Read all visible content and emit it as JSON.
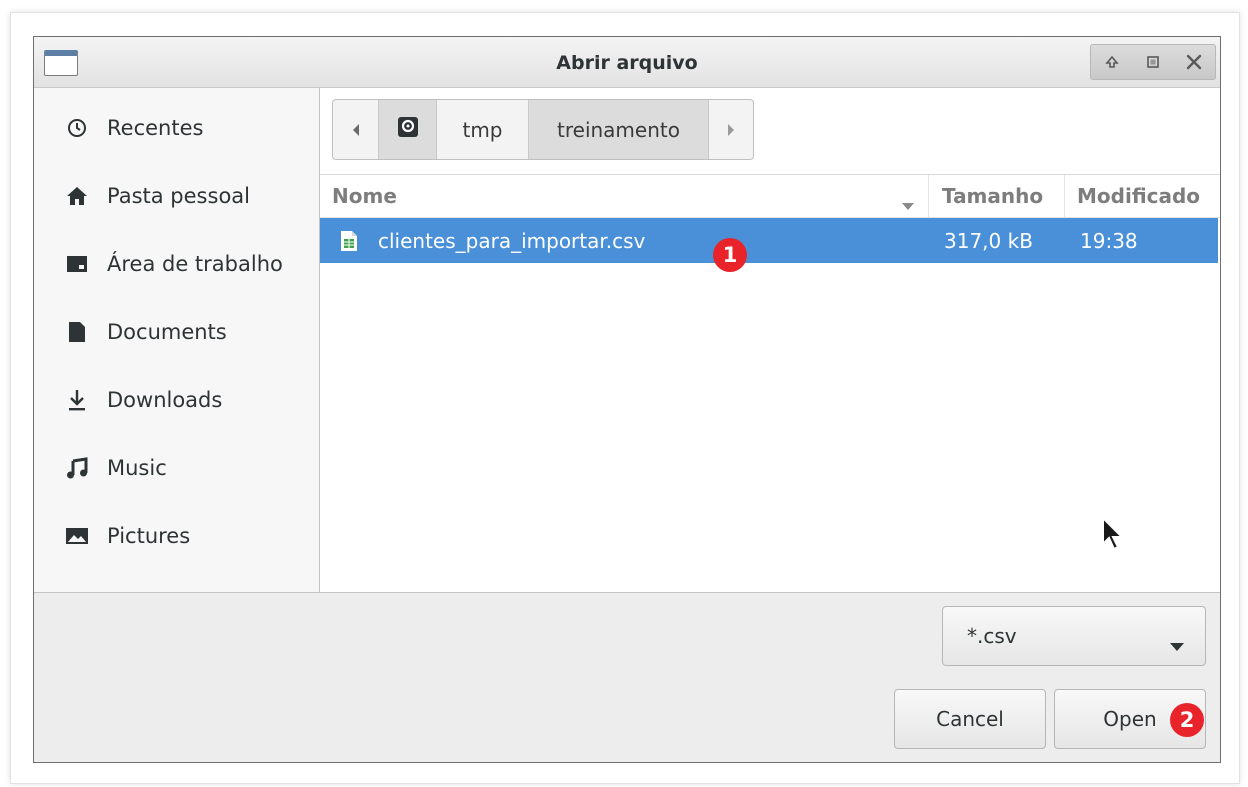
{
  "window": {
    "title": "Abrir arquivo"
  },
  "sidebar": {
    "items": [
      {
        "label": "Recentes",
        "icon": "clock-icon"
      },
      {
        "label": "Pasta pessoal",
        "icon": "home-icon"
      },
      {
        "label": "Área de trabalho",
        "icon": "desktop-icon"
      },
      {
        "label": "Documents",
        "icon": "document-icon"
      },
      {
        "label": "Downloads",
        "icon": "download-icon"
      },
      {
        "label": "Music",
        "icon": "music-icon"
      },
      {
        "label": "Pictures",
        "icon": "picture-icon"
      }
    ]
  },
  "pathbar": {
    "segments": [
      "tmp",
      "treinamento"
    ],
    "active": "treinamento"
  },
  "columns": {
    "name": "Nome",
    "size": "Tamanho",
    "modified": "Modificado"
  },
  "files": [
    {
      "name": "clientes_para_importar.csv",
      "size": "317,0 kB",
      "modified": "19:38",
      "selected": true
    }
  ],
  "filter": {
    "selected": "*.csv"
  },
  "buttons": {
    "cancel": "Cancel",
    "open": "Open"
  },
  "annotations": {
    "step1": "1",
    "step2": "2"
  },
  "colors": {
    "selection": "#4a90d9",
    "badge": "#e8232a",
    "csv_icon": "#3fa34d"
  }
}
